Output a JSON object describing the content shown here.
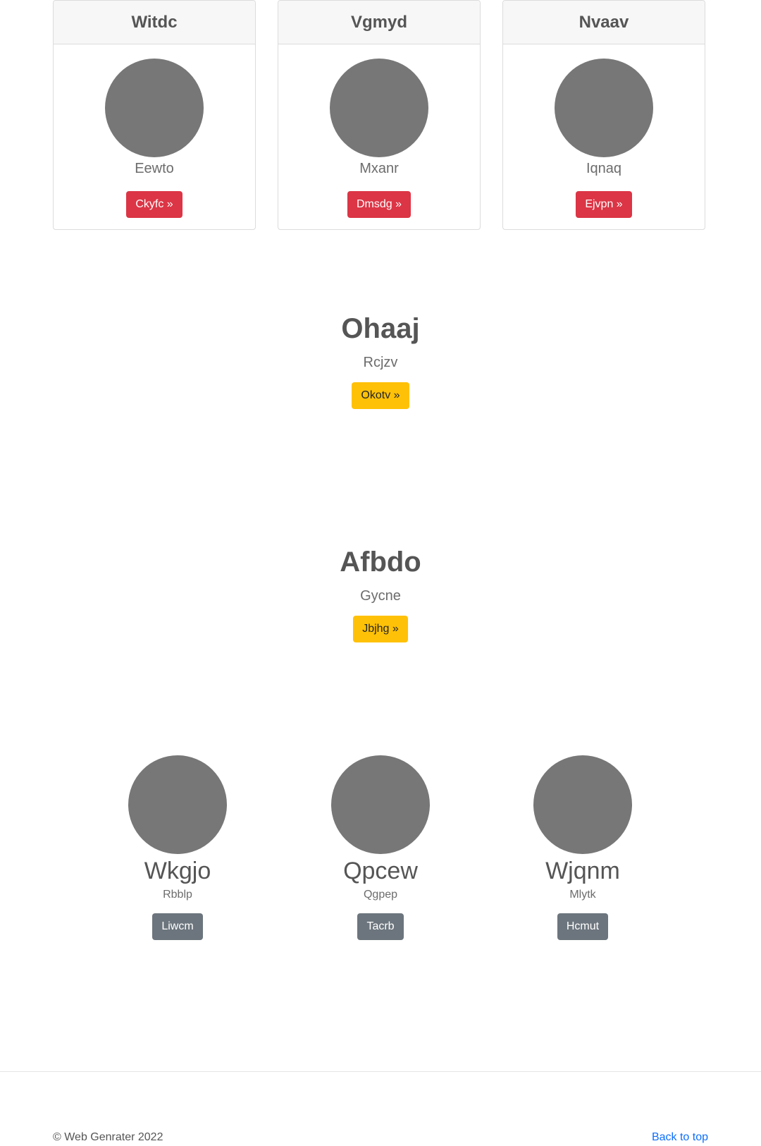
{
  "cards": [
    {
      "title": "Witdc",
      "subtitle": "Eewto",
      "button": "Ckyfc »"
    },
    {
      "title": "Vgmyd",
      "subtitle": "Mxanr",
      "button": "Dmsdg »"
    },
    {
      "title": "Nvaav",
      "subtitle": "Iqnaq",
      "button": "Ejvpn »"
    }
  ],
  "heroes": [
    {
      "title": "Ohaaj",
      "subtitle": "Rcjzv",
      "button": "Okotv »"
    },
    {
      "title": "Afbdo",
      "subtitle": "Gycne",
      "button": "Jbjhg »"
    }
  ],
  "features": [
    {
      "title": "Wkgjo",
      "subtitle": "Rbblp",
      "button": "Liwcm"
    },
    {
      "title": "Qpcew",
      "subtitle": "Qgpep",
      "button": "Tacrb"
    },
    {
      "title": "Wjqnm",
      "subtitle": "Mlytk",
      "button": "Hcmut"
    }
  ],
  "footer": {
    "copyright": "© Web Genrater 2022",
    "back_to_top": "Back to top"
  },
  "colors": {
    "danger": "#dc3545",
    "warning": "#ffc107",
    "secondary": "#6c757d",
    "placeholder": "#777777",
    "link": "#0d6efd"
  }
}
